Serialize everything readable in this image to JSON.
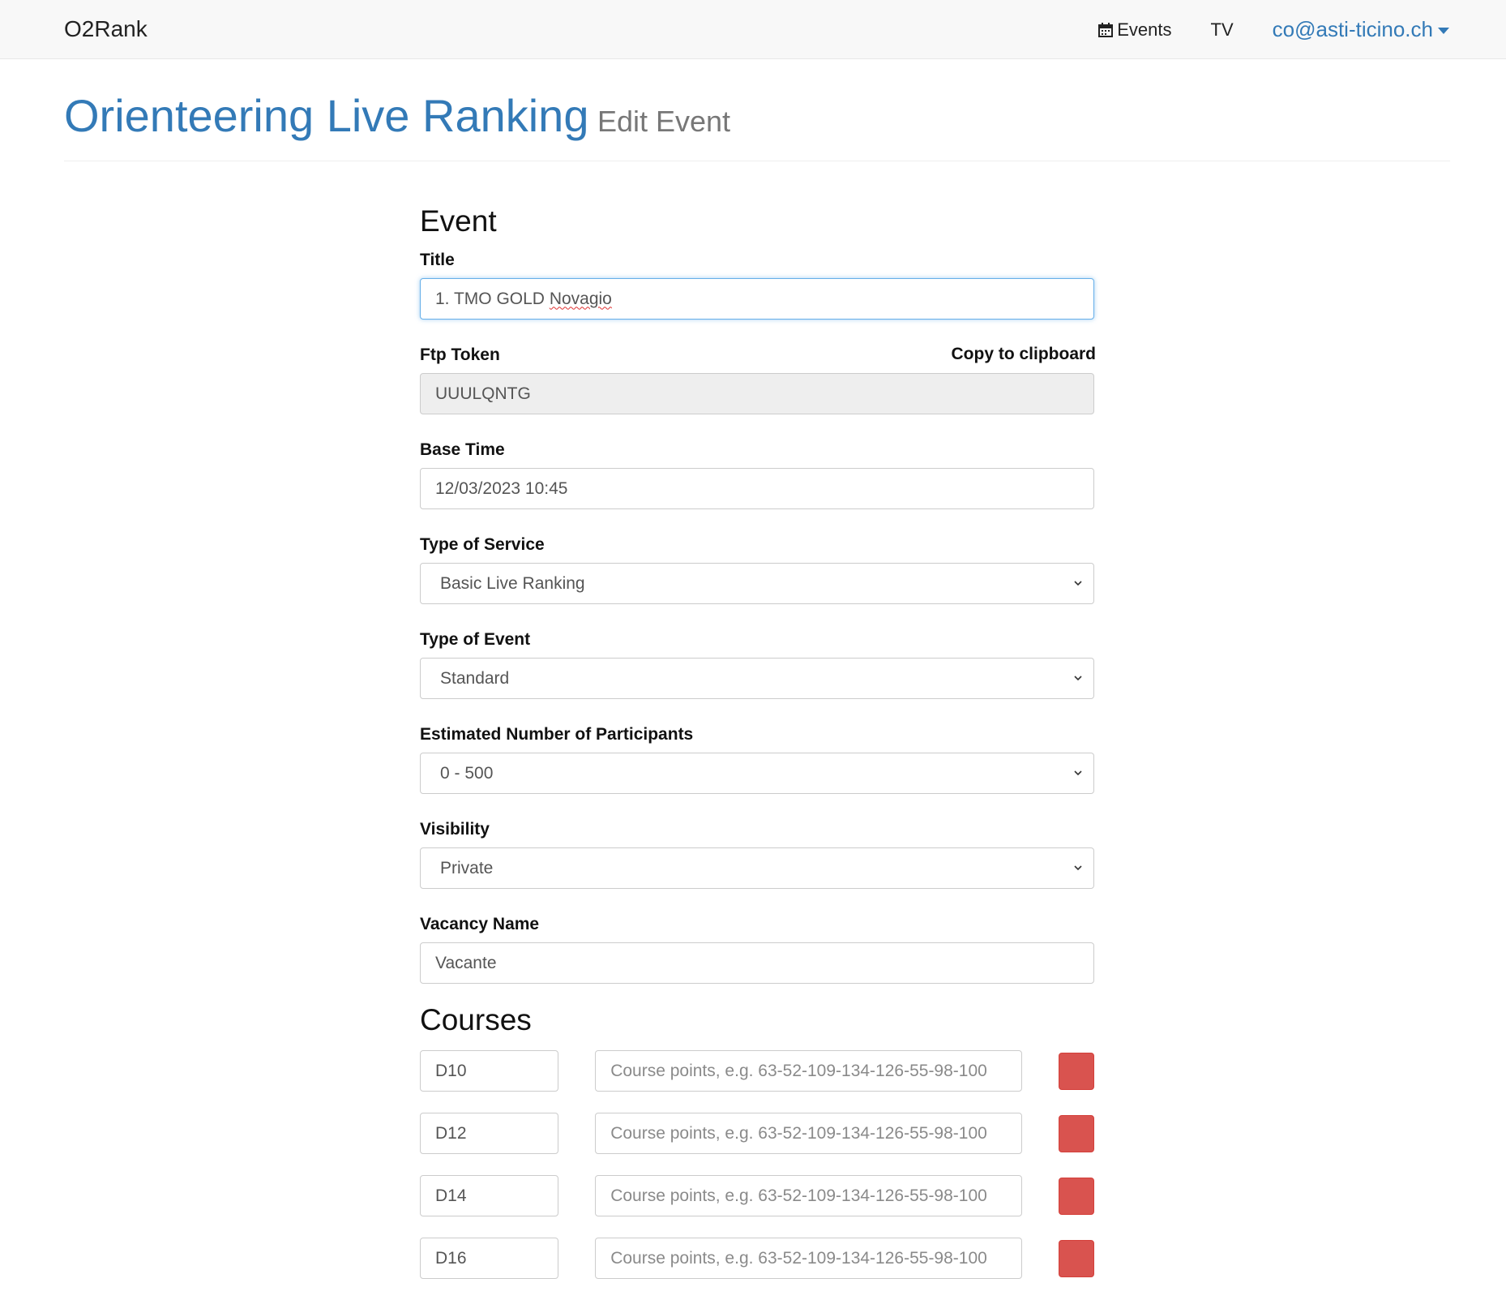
{
  "navbar": {
    "brand": "O2Rank",
    "events_label": "Events",
    "tv_label": "TV",
    "user_label": "co@asti-ticino.ch"
  },
  "header": {
    "title": "Orienteering Live Ranking",
    "subtitle": "Edit Event"
  },
  "event_section": {
    "heading": "Event",
    "title_label": "Title",
    "title_value": "1. TMO GOLD ",
    "title_value_flagged": "Novagio",
    "ftp_token_label": "Ftp Token",
    "copy_label": "Copy to clipboard",
    "ftp_token_value": "UUULQNTG",
    "base_time_label": "Base Time",
    "base_time_value": "12/03/2023 10:45",
    "service_label": "Type of Service",
    "service_value": "Basic Live Ranking",
    "event_type_label": "Type of Event",
    "event_type_value": "Standard",
    "participants_label": "Estimated Number of Participants",
    "participants_value": "0 - 500",
    "visibility_label": "Visibility",
    "visibility_value": "Private",
    "vacancy_label": "Vacancy Name",
    "vacancy_value": "Vacante"
  },
  "courses_section": {
    "heading": "Courses",
    "points_placeholder": "Course points, e.g. 63-52-109-134-126-55-98-100",
    "courses": [
      {
        "name": "D10"
      },
      {
        "name": "D12"
      },
      {
        "name": "D14"
      },
      {
        "name": "D16"
      }
    ]
  },
  "colors": {
    "brand_blue": "#337ab7",
    "danger_red": "#d9534f",
    "navbar_bg": "#f8f8f8"
  }
}
